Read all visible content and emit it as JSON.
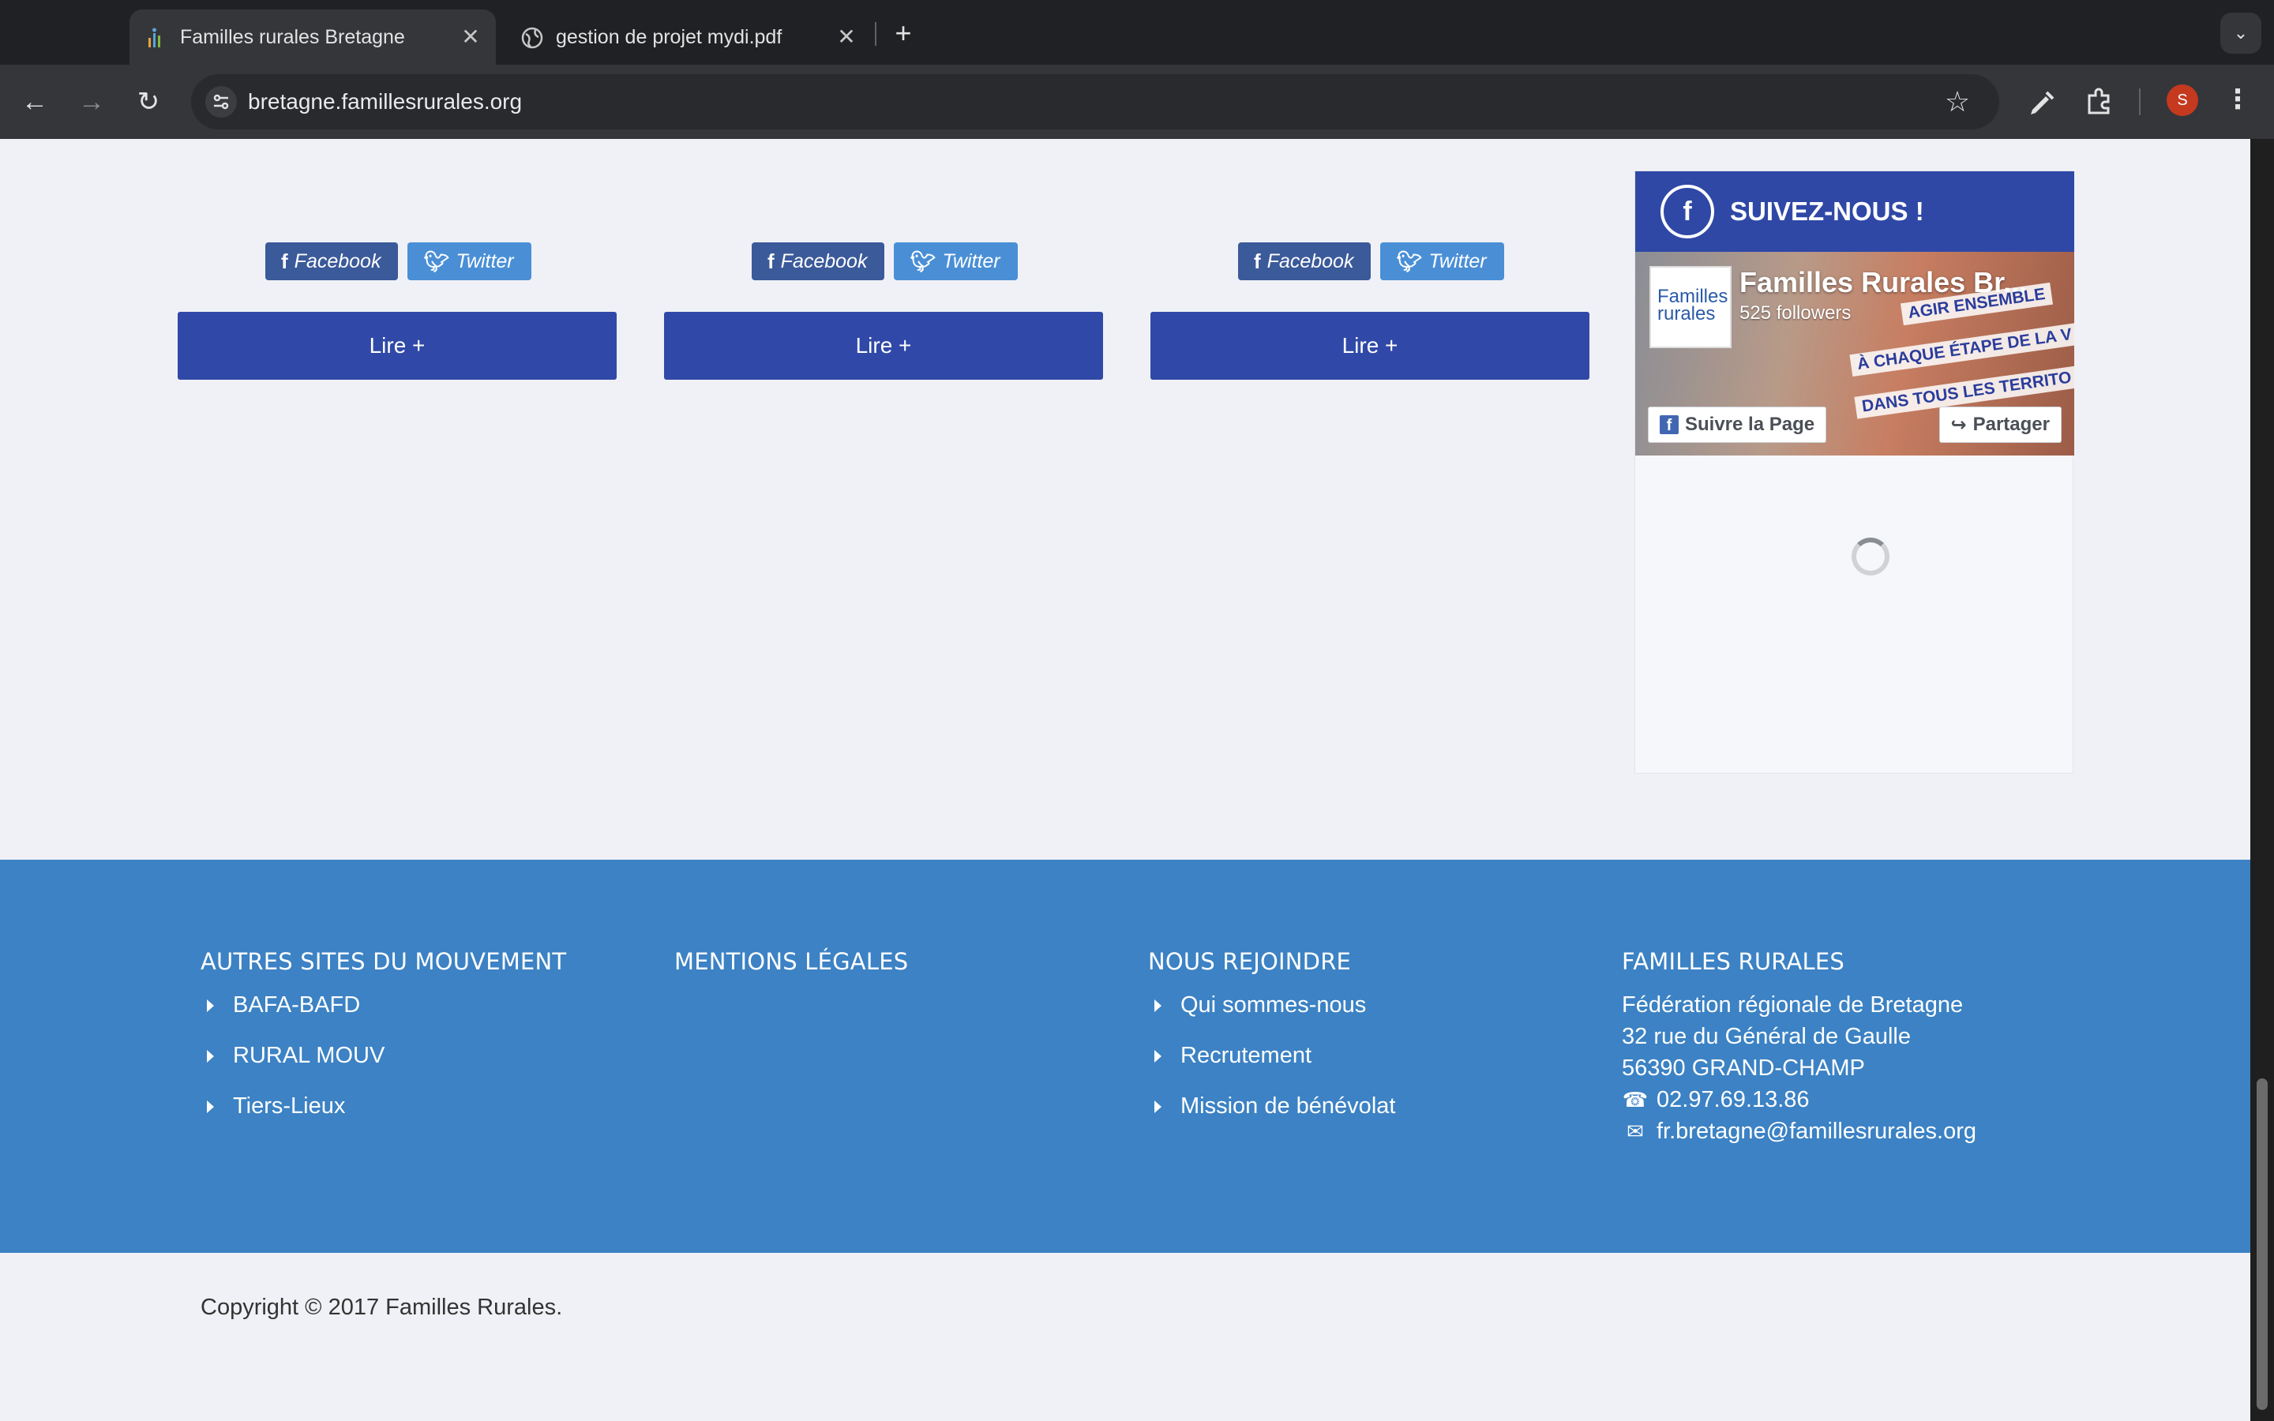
{
  "browser": {
    "tabs": [
      {
        "title": "Familles rurales Bretagne",
        "active": true
      },
      {
        "title": "gestion de projet mydi.pdf",
        "active": false
      }
    ],
    "new_tab": "+",
    "url": "bretagne.famillesrurales.org",
    "profile_initial": "S"
  },
  "articles": [
    {
      "share_facebook": "Facebook",
      "share_twitter": "Twitter",
      "read_more": "Lire +"
    },
    {
      "share_facebook": "Facebook",
      "share_twitter": "Twitter",
      "read_more": "Lire +"
    },
    {
      "share_facebook": "Facebook",
      "share_twitter": "Twitter",
      "read_more": "Lire +"
    }
  ],
  "social": {
    "header": "SUIVEZ-NOUS !",
    "page_name": "Familles Rurales Br...",
    "followers": "525 followers",
    "banner_lines": [
      "AGIR ENSEMBLE",
      "À CHAQUE ÉTAPE DE LA V",
      "DANS TOUS LES TERRITO"
    ],
    "follow_label": "Suivre la Page",
    "share_label": "Partager",
    "logo_text": "Familles rurales"
  },
  "footer": {
    "col1": {
      "heading": "AUTRES SITES DU MOUVEMENT",
      "links": [
        "BAFA-BAFD",
        "RURAL MOUV",
        "Tiers-Lieux"
      ]
    },
    "col2": {
      "heading": "MENTIONS LÉGALES"
    },
    "col3": {
      "heading": "NOUS REJOINDRE",
      "links": [
        "Qui sommes-nous",
        "Recrutement",
        "Mission de bénévolat"
      ]
    },
    "col4": {
      "heading": "FAMILLES RURALES",
      "lines": [
        "Fédération régionale de Bretagne",
        "32 rue du Général de Gaulle",
        "56390 GRAND-CHAMP"
      ],
      "phone": "02.97.69.13.86",
      "email": "fr.bretagne@famillesrurales.org"
    },
    "copyright": "Copyright © 2017 Familles Rurales."
  },
  "colors": {
    "brand_blue": "#3049a8",
    "footer_blue": "#3c82c4",
    "facebook": "#3b5a9a",
    "twitter": "#4a8fd6"
  }
}
